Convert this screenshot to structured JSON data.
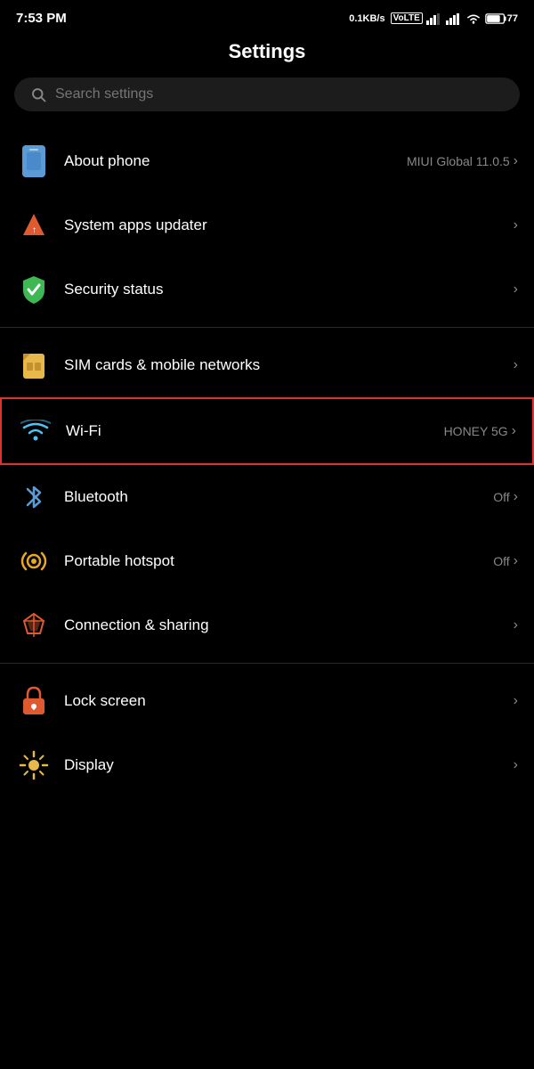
{
  "statusBar": {
    "time": "7:53 PM",
    "network": "0.1KB/s",
    "networkType": "VoLTE",
    "battery": "77"
  },
  "page": {
    "title": "Settings"
  },
  "search": {
    "placeholder": "Search settings"
  },
  "items": [
    {
      "id": "about-phone",
      "label": "About phone",
      "value": "MIUI Global 11.0.5",
      "iconColor": "#5b9bd5",
      "group": "top"
    },
    {
      "id": "system-apps-updater",
      "label": "System apps updater",
      "value": "",
      "iconColor": "#e05a30",
      "group": "top"
    },
    {
      "id": "security-status",
      "label": "Security status",
      "value": "",
      "iconColor": "#3db852",
      "group": "top"
    },
    {
      "id": "sim-cards",
      "label": "SIM cards & mobile networks",
      "value": "",
      "iconColor": "#e8b84b",
      "group": "network"
    },
    {
      "id": "wifi",
      "label": "Wi-Fi",
      "value": "HONEY 5G",
      "iconColor": "#4fc3f7",
      "group": "network",
      "highlighted": true
    },
    {
      "id": "bluetooth",
      "label": "Bluetooth",
      "value": "Off",
      "iconColor": "#5b9bd5",
      "group": "network"
    },
    {
      "id": "portable-hotspot",
      "label": "Portable hotspot",
      "value": "Off",
      "iconColor": "#e8a825",
      "group": "network"
    },
    {
      "id": "connection-sharing",
      "label": "Connection & sharing",
      "value": "",
      "iconColor": "#e05a30",
      "group": "network"
    },
    {
      "id": "lock-screen",
      "label": "Lock screen",
      "value": "",
      "iconColor": "#e05a30",
      "group": "display"
    },
    {
      "id": "display",
      "label": "Display",
      "value": "",
      "iconColor": "#e8b84b",
      "group": "display"
    }
  ]
}
